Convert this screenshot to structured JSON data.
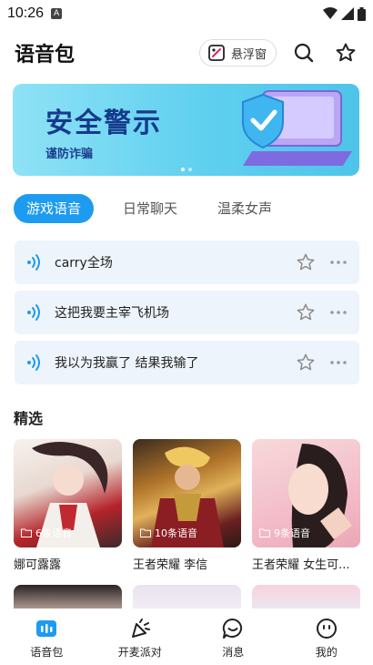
{
  "status": {
    "time": "10:26"
  },
  "header": {
    "title": "语音包",
    "float_label": "悬浮窗"
  },
  "banner": {
    "title": "安全警示",
    "subtitle": "谨防诈骗"
  },
  "tabs": [
    {
      "label": "游戏语音",
      "active": true
    },
    {
      "label": "日常聊天",
      "active": false
    },
    {
      "label": "温柔女声",
      "active": false
    }
  ],
  "voices": [
    {
      "label": "carry全场"
    },
    {
      "label": "这把我要主宰飞机场"
    },
    {
      "label": "我以为我赢了 结果我输了"
    }
  ],
  "featured": {
    "title": "精选",
    "cards": [
      {
        "count": "6条语音",
        "name": "娜可露露"
      },
      {
        "count": "10条语音",
        "name": "王者荣耀 李信"
      },
      {
        "count": "9条语音",
        "name": "王者荣耀 女生可..."
      }
    ]
  },
  "nav": [
    {
      "label": "语音包",
      "active": true
    },
    {
      "label": "开麦派对",
      "active": false
    },
    {
      "label": "消息",
      "active": false
    },
    {
      "label": "我的",
      "active": false
    }
  ],
  "colors": {
    "accent": "#1d9bf0",
    "item_bg": "#eef4fb"
  }
}
